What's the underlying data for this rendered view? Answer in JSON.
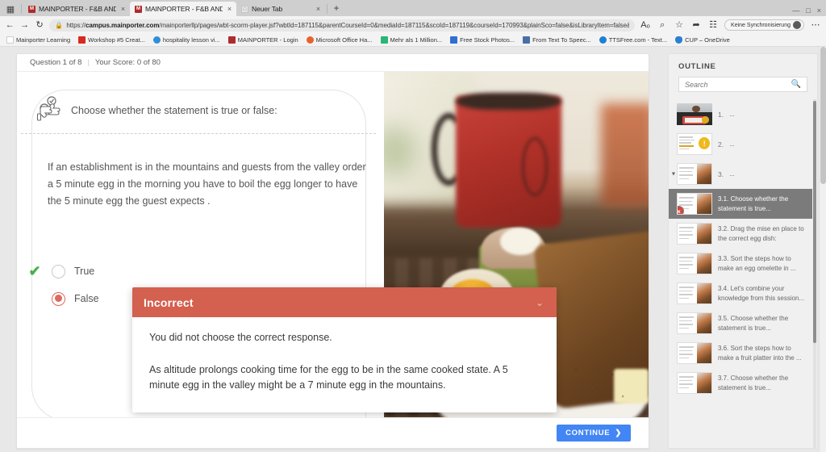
{
  "browser": {
    "tabs": [
      {
        "title": "MAINPORTER - F&B AND KITCH",
        "favicon_letter": "M",
        "active": false
      },
      {
        "title": "MAINPORTER - F&B AND KITCH",
        "favicon_letter": "M",
        "active": true
      },
      {
        "title": "Neuer Tab",
        "favicon_letter": "",
        "active": false
      }
    ],
    "new_tab_label": "+",
    "close_label": "×",
    "window_controls": {
      "minimize": "—",
      "maximize": "□",
      "close": "×"
    },
    "nav": {
      "back": "←",
      "forward": "→",
      "reload": "↻"
    },
    "omnibox": {
      "lock_icon": "lock-icon",
      "url_prefix": "https://",
      "url_host": "campus.mainporter.com",
      "url_rest": "/mainporterllp/pages/wbt-scorm-player.jsf?wbtId=187115&parentCourseId=0&mediaId=187115&scoId=187119&courseId=170993&plainSco=false&isLibraryItem=false&openMode=new-window"
    },
    "toolbar_icons": [
      "read-aloud-icon",
      "collections-icon",
      "favorites-icon",
      "share-icon",
      "browser-essentials-icon"
    ],
    "profile": {
      "label": "Keine Synchronisierung",
      "avatar": "user-avatar"
    },
    "more_label": "⋯",
    "bookmarks": [
      {
        "label": "Mainporter Learning",
        "color": "#ffffff"
      },
      {
        "label": "Workshop #5 Creat...",
        "color": "#d8291c"
      },
      {
        "label": "hospitality lesson vi...",
        "color": "#2f8fd8"
      },
      {
        "label": "MAINPORTER - Login",
        "color": "#b02a2a"
      },
      {
        "label": "Microsoft Office Ha...",
        "color": "#e8622c"
      },
      {
        "label": "Mehr als 1 Million...",
        "color": "#2bb673"
      },
      {
        "label": "Free Stock Photos...",
        "color": "#2f6fd0"
      },
      {
        "label": "From Text To Speec...",
        "color": "#4a6fa5"
      },
      {
        "label": "TTSFree.com - Text...",
        "color": "#1f7fd4"
      },
      {
        "label": "CUP – OneDrive",
        "color": "#2a7fd4"
      }
    ]
  },
  "player": {
    "progress": "Question 1 of 8",
    "divider": "|",
    "score": "Your Score: 0 of 80",
    "question": {
      "icon": "thumbs-up-down-icon",
      "prompt": "Choose whether the statement is true or false:",
      "statement": "If an establishment is in the mountains and guests from the valley order a 5 minute egg in the morning you have to boil the egg longer to have the 5 minute egg the guest expects .",
      "choices": [
        {
          "label": "True",
          "selected": false,
          "correct_marker": "✔"
        },
        {
          "label": "False",
          "selected": true,
          "correct_marker": ""
        }
      ]
    },
    "image_alt": "breakfast-photo-boiled-eggs-toast-red-mug",
    "feedback": {
      "title": "Incorrect",
      "collapse_icon": "chevron-down-icon",
      "paragraphs": [
        "You did not choose the correct response.",
        "As altitude prolongs cooking time for the egg to be in the same cooked state. A 5 minute egg in the valley might be a 7 minute egg in the mountains."
      ],
      "header_color": "#d4604f"
    },
    "continue_label": "CONTINUE",
    "continue_arrow": "❯",
    "continue_color": "#4285f4"
  },
  "outline": {
    "title": "OUTLINE",
    "search_placeholder": "Search",
    "search_value": "",
    "search_icon": "search-icon",
    "items": [
      {
        "num": "1.",
        "label": "...",
        "thumb": "person",
        "selected": false,
        "expandable": false,
        "status": ""
      },
      {
        "num": "2.",
        "label": "...",
        "thumb": "doc-badge",
        "selected": false,
        "expandable": false,
        "status": ""
      },
      {
        "num": "3.",
        "label": "...",
        "thumb": "doc-photo",
        "selected": false,
        "expandable": true,
        "status": ""
      },
      {
        "num": "",
        "label": "3.1. Choose whether the statement is true...",
        "thumb": "doc-photo",
        "selected": true,
        "expandable": false,
        "status": "incorrect"
      },
      {
        "num": "",
        "label": "3.2. Drag the mise en place to the correct egg dish:",
        "thumb": "doc-photo",
        "selected": false,
        "expandable": false,
        "status": ""
      },
      {
        "num": "",
        "label": "3.3. Sort the steps how to make an egg omelette in ...",
        "thumb": "doc-photo",
        "selected": false,
        "expandable": false,
        "status": ""
      },
      {
        "num": "",
        "label": "3.4. Let's combine your knowledge from this session...",
        "thumb": "doc-photo",
        "selected": false,
        "expandable": false,
        "status": ""
      },
      {
        "num": "",
        "label": "3.5. Choose whether the statement is true...",
        "thumb": "doc-photo",
        "selected": false,
        "expandable": false,
        "status": ""
      },
      {
        "num": "",
        "label": "3.6. Sort the steps how to make a fruit platter into the ...",
        "thumb": "doc-photo",
        "selected": false,
        "expandable": false,
        "status": ""
      },
      {
        "num": "",
        "label": "3.7. Choose whether the statement is true...",
        "thumb": "doc-photo",
        "selected": false,
        "expandable": false,
        "status": ""
      }
    ],
    "status_icon_incorrect": "×"
  }
}
